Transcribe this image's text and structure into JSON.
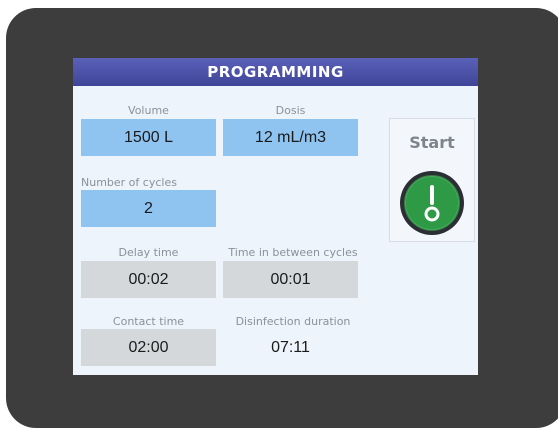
{
  "screen": {
    "title": "PROGRAMMING",
    "volume": {
      "label": "Volume",
      "value": "1500 L"
    },
    "dosis": {
      "label": "Dosis",
      "value": "12 mL/m3"
    },
    "cycles": {
      "label": "Number of cycles",
      "value": "2"
    },
    "delay": {
      "label": "Delay time",
      "value": "00:02"
    },
    "between": {
      "label": "Time in between cycles",
      "value": "00:01"
    },
    "contact": {
      "label": "Contact time",
      "value": "02:00"
    },
    "duration": {
      "label": "Disinfection duration",
      "value": "07:11"
    },
    "start": {
      "label": "Start"
    }
  },
  "colors": {
    "bezel": "#3d3d3d",
    "title_bar": "#4a51a8",
    "field_blue": "#8fc3f0",
    "field_grey": "#d5d8db",
    "start_green": "#2e9a45"
  },
  "icons": {
    "start": "power-toggle-icon"
  }
}
